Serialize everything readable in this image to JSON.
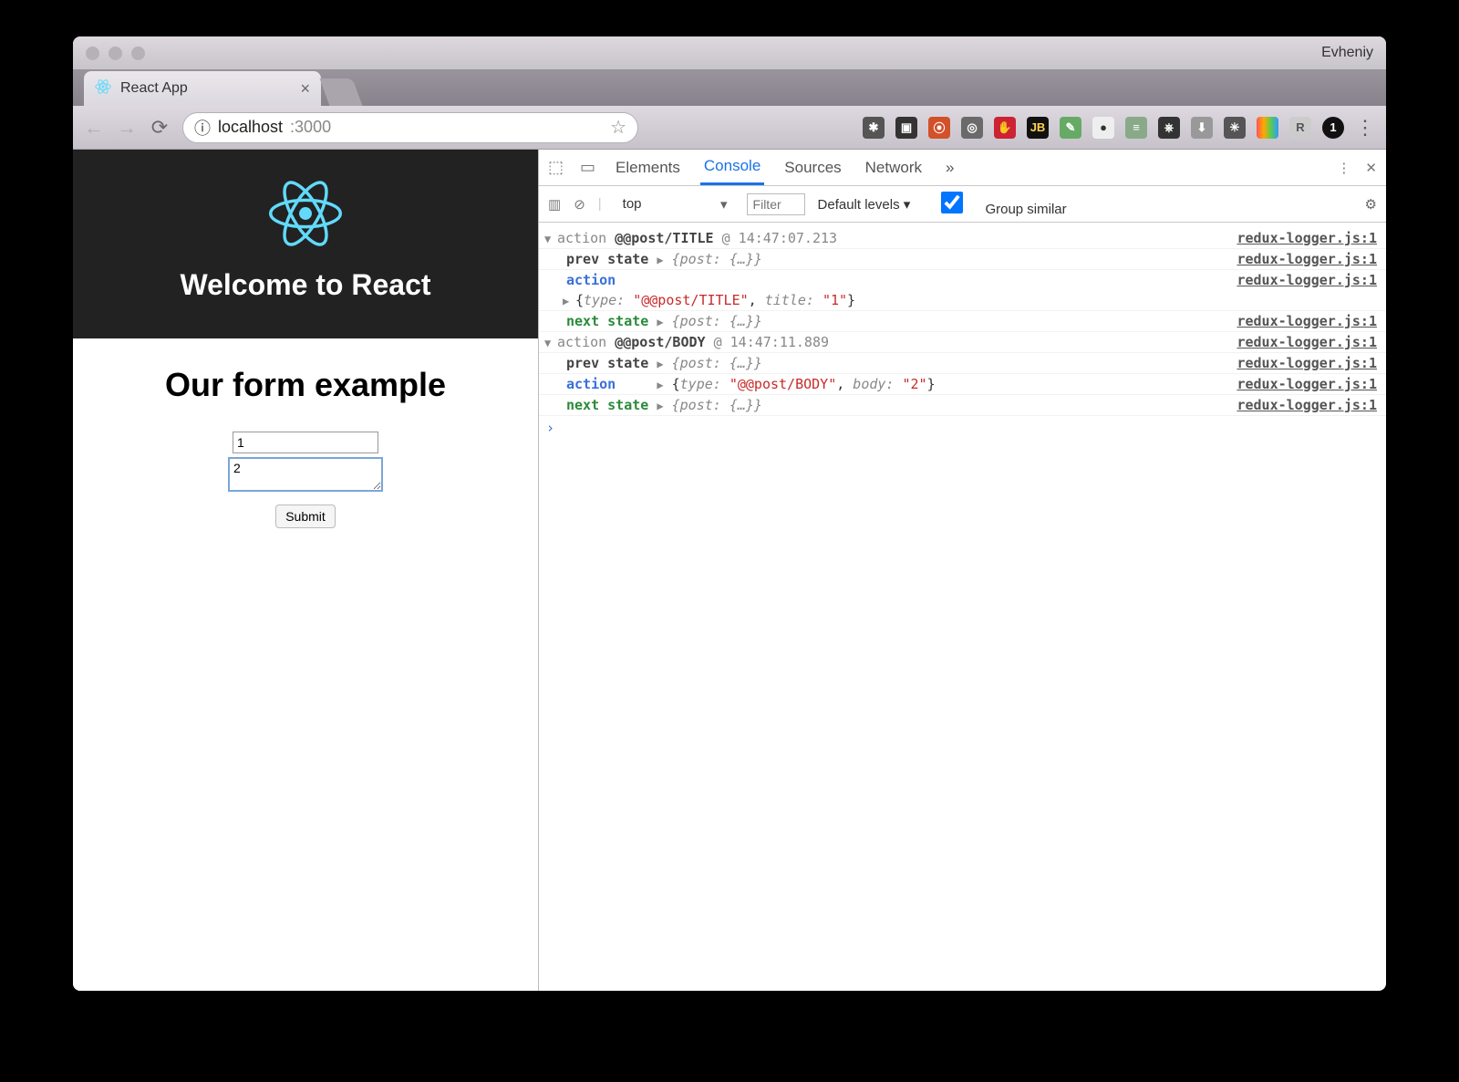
{
  "browser": {
    "profile": "Evheniy",
    "tab_title": "React App",
    "url_host": "localhost",
    "url_port": ":3000",
    "back": "←",
    "forward": "→",
    "reload": "⟳",
    "info": "ⓘ",
    "star": "☆",
    "menu": "⋮"
  },
  "page": {
    "hero_title": "Welcome to React",
    "form_heading": "Our form example",
    "title_value": "1",
    "body_value": "2",
    "submit_label": "Submit"
  },
  "devtools": {
    "tabs": {
      "elements": "Elements",
      "console": "Console",
      "sources": "Sources",
      "network": "Network",
      "more": "»"
    },
    "filter": {
      "context": "top",
      "placeholder": "Filter",
      "levels": "Default levels ▾",
      "group": "Group similar"
    },
    "src": "redux-logger.js:1",
    "logs": [
      {
        "header_pre": "action ",
        "header_name": "@@post/TITLE",
        "header_time": " @ 14:47:07.213",
        "prev_label": "prev state",
        "prev_obj": "{post: {…}}",
        "action_label": "action",
        "action_obj_open": "{",
        "action_type_key": "type: ",
        "action_type_val": "\"@@post/TITLE\"",
        "action_sep": ", ",
        "action_pkey": "title: ",
        "action_pval": "\"1\"",
        "action_obj_close": "}",
        "next_label": "next state",
        "next_obj": "{post: {…}}"
      },
      {
        "header_pre": "action ",
        "header_name": "@@post/BODY",
        "header_time": " @ 14:47:11.889",
        "prev_label": "prev state",
        "prev_obj": "{post: {…}}",
        "action_label": "action",
        "action_obj_open": "{",
        "action_type_key": "type: ",
        "action_type_val": "\"@@post/BODY\"",
        "action_sep": ", ",
        "action_pkey": "body: ",
        "action_pval": "\"2\"",
        "action_obj_close": "}",
        "next_label": "next state",
        "next_obj": "{post: {…}}"
      }
    ],
    "prompt": "›"
  }
}
